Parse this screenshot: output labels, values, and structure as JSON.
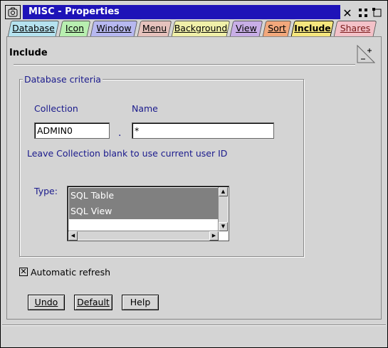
{
  "window": {
    "title": "MISC - Properties",
    "title_bar_color": "#1e13b8"
  },
  "tabs": [
    {
      "label": "Database",
      "color": "#b5e2ef"
    },
    {
      "label": "Icon",
      "color": "#b8efb0"
    },
    {
      "label": "Window",
      "color": "#b7b8f0"
    },
    {
      "label": "Menu",
      "color": "#e6c2bd"
    },
    {
      "label": "Background",
      "color": "#f0f0a9"
    },
    {
      "label": "View",
      "color": "#c8aee6"
    },
    {
      "label": "Sort",
      "color": "#f2a87c"
    },
    {
      "label": "Include",
      "color": "#f5e67e",
      "active": true
    },
    {
      "label": "Shares",
      "color": "#f3c1c8"
    }
  ],
  "page": {
    "title": "Include",
    "group_label": "Database criteria",
    "collection_label": "Collection",
    "collection_value": "ADMIN0",
    "name_label": "Name",
    "name_value": "*",
    "separator": ".",
    "hint": "Leave Collection blank to use current user ID",
    "type_label": "Type:",
    "type_options": [
      "SQL Table",
      "SQL View"
    ],
    "auto_refresh_label": "Automatic refresh",
    "auto_refresh_checked": true
  },
  "buttons": {
    "undo": "Undo",
    "default": "Default",
    "help": "Help"
  },
  "icons": {
    "system_menu": "window-system-menu-icon",
    "close": "close-icon",
    "restore": "restore-icon",
    "minimize": "minimize-icon",
    "page_corner": "page-dogear-icon"
  }
}
